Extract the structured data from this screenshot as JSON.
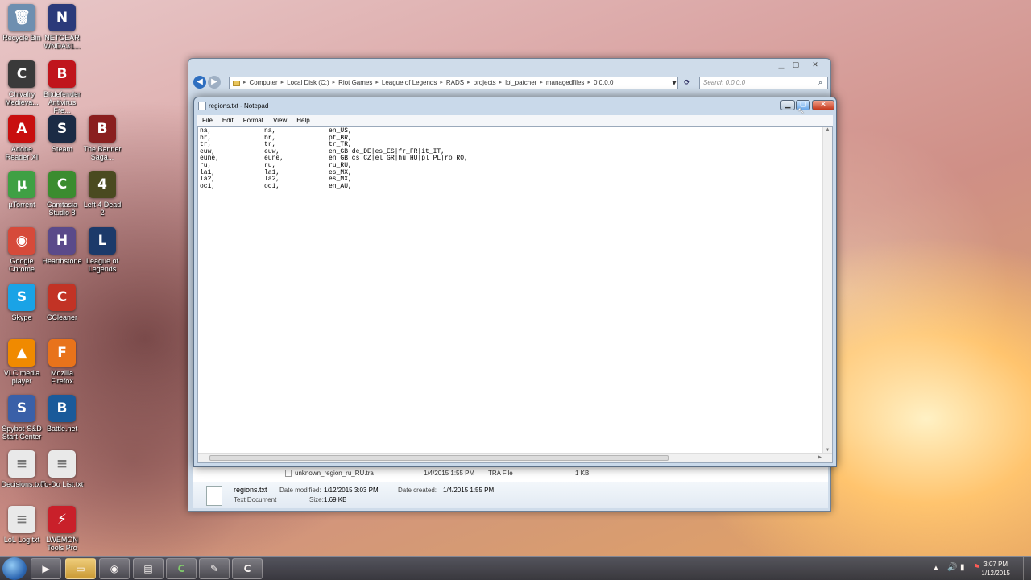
{
  "desktop": {
    "icons": [
      {
        "label": "Recycle Bin",
        "glyph": "🗑",
        "color": "#6e8fb0"
      },
      {
        "label": "NETGEAR WNDA31...",
        "glyph": "N",
        "color": "#2b3a7a"
      },
      {
        "label": "Chivalry Medieva...",
        "glyph": "C",
        "color": "#3a3a3a"
      },
      {
        "label": "Bitdefender Antivirus Fre...",
        "glyph": "B",
        "color": "#c0151c"
      },
      {
        "label": "Adobe Reader XI",
        "glyph": "A",
        "color": "#c80f0f"
      },
      {
        "label": "Steam",
        "glyph": "S",
        "color": "#1b2b45"
      },
      {
        "label": "The Banner Saga...",
        "glyph": "B",
        "color": "#8a1f1f"
      },
      {
        "label": "µTorrent",
        "glyph": "µ",
        "color": "#3fa044"
      },
      {
        "label": "Camtasia Studio 8",
        "glyph": "C",
        "color": "#3b8c2f"
      },
      {
        "label": "Left 4 Dead 2",
        "glyph": "4",
        "color": "#4a4a20"
      },
      {
        "label": "Google Chrome",
        "glyph": "◉",
        "color": "#d64a3a"
      },
      {
        "label": "Hearthstone",
        "glyph": "H",
        "color": "#5a4a8a"
      },
      {
        "label": "League of Legends",
        "glyph": "L",
        "color": "#1c3a6a"
      },
      {
        "label": "Skype",
        "glyph": "S",
        "color": "#1aa3e6"
      },
      {
        "label": "CCleaner",
        "glyph": "C",
        "color": "#c23325"
      },
      {
        "label": "VLC media player",
        "glyph": "▲",
        "color": "#f08a00"
      },
      {
        "label": "Mozilla Firefox",
        "glyph": "F",
        "color": "#e8731b"
      },
      {
        "label": "Spybot-S&D Start Center",
        "glyph": "S",
        "color": "#3a60a8"
      },
      {
        "label": "Battle.net",
        "glyph": "B",
        "color": "#1a5a9a"
      },
      {
        "label": "Decisions.txt",
        "glyph": "≡",
        "color": "#e9e9e9"
      },
      {
        "label": "To-Do List.txt",
        "glyph": "≡",
        "color": "#e9e9e9"
      },
      {
        "label": "LoL Log.txt",
        "glyph": "≡",
        "color": "#e9e9e9"
      },
      {
        "label": "LWEMON Tools Pro",
        "glyph": "⚡",
        "color": "#c9202a"
      }
    ]
  },
  "explorer": {
    "breadcrumbs": [
      "Computer",
      "Local Disk (C:)",
      "Riot Games",
      "League of Legends",
      "RADS",
      "projects",
      "lol_patcher",
      "managedfiles",
      "0.0.0.0"
    ],
    "search_placeholder": "Search 0.0.0.0",
    "file_row": {
      "name": "unknown_region_ru_RU.tra",
      "date": "1/4/2015 1:55 PM",
      "type": "TRA File",
      "size": "1 KB"
    },
    "details": {
      "name": "regions.txt",
      "type": "Text Document",
      "modified_label": "Date modified:",
      "modified": "1/12/2015 3:03 PM",
      "created_label": "Date created:",
      "created": "1/4/2015 1:55 PM",
      "size_label": "Size:",
      "size": "1.69 KB"
    }
  },
  "notepad": {
    "title": "regions.txt - Notepad",
    "menu": [
      "File",
      "Edit",
      "Format",
      "View",
      "Help"
    ],
    "rows": [
      [
        "na,",
        "na,",
        "en_US,"
      ],
      [
        "br,",
        "br,",
        "pt_BR,"
      ],
      [
        "tr,",
        "tr,",
        "tr_TR,"
      ],
      [
        "euw,",
        "euw,",
        "en_GB|de_DE|es_ES|fr_FR|it_IT,"
      ],
      [
        "eune,",
        "eune,",
        "en_GB|cs_CZ|el_GR|hu_HU|pl_PL|ro_RO,"
      ],
      [
        "ru,",
        "ru,",
        "ru_RU,"
      ],
      [
        "la1,",
        "la1,",
        "es_MX,"
      ],
      [
        "la2,",
        "la2,",
        "es_MX,"
      ],
      [
        "oc1,",
        "oc1,",
        "en_AU,"
      ]
    ]
  },
  "taskbar": {
    "time": "3:07 PM",
    "date": "1/12/2015"
  }
}
